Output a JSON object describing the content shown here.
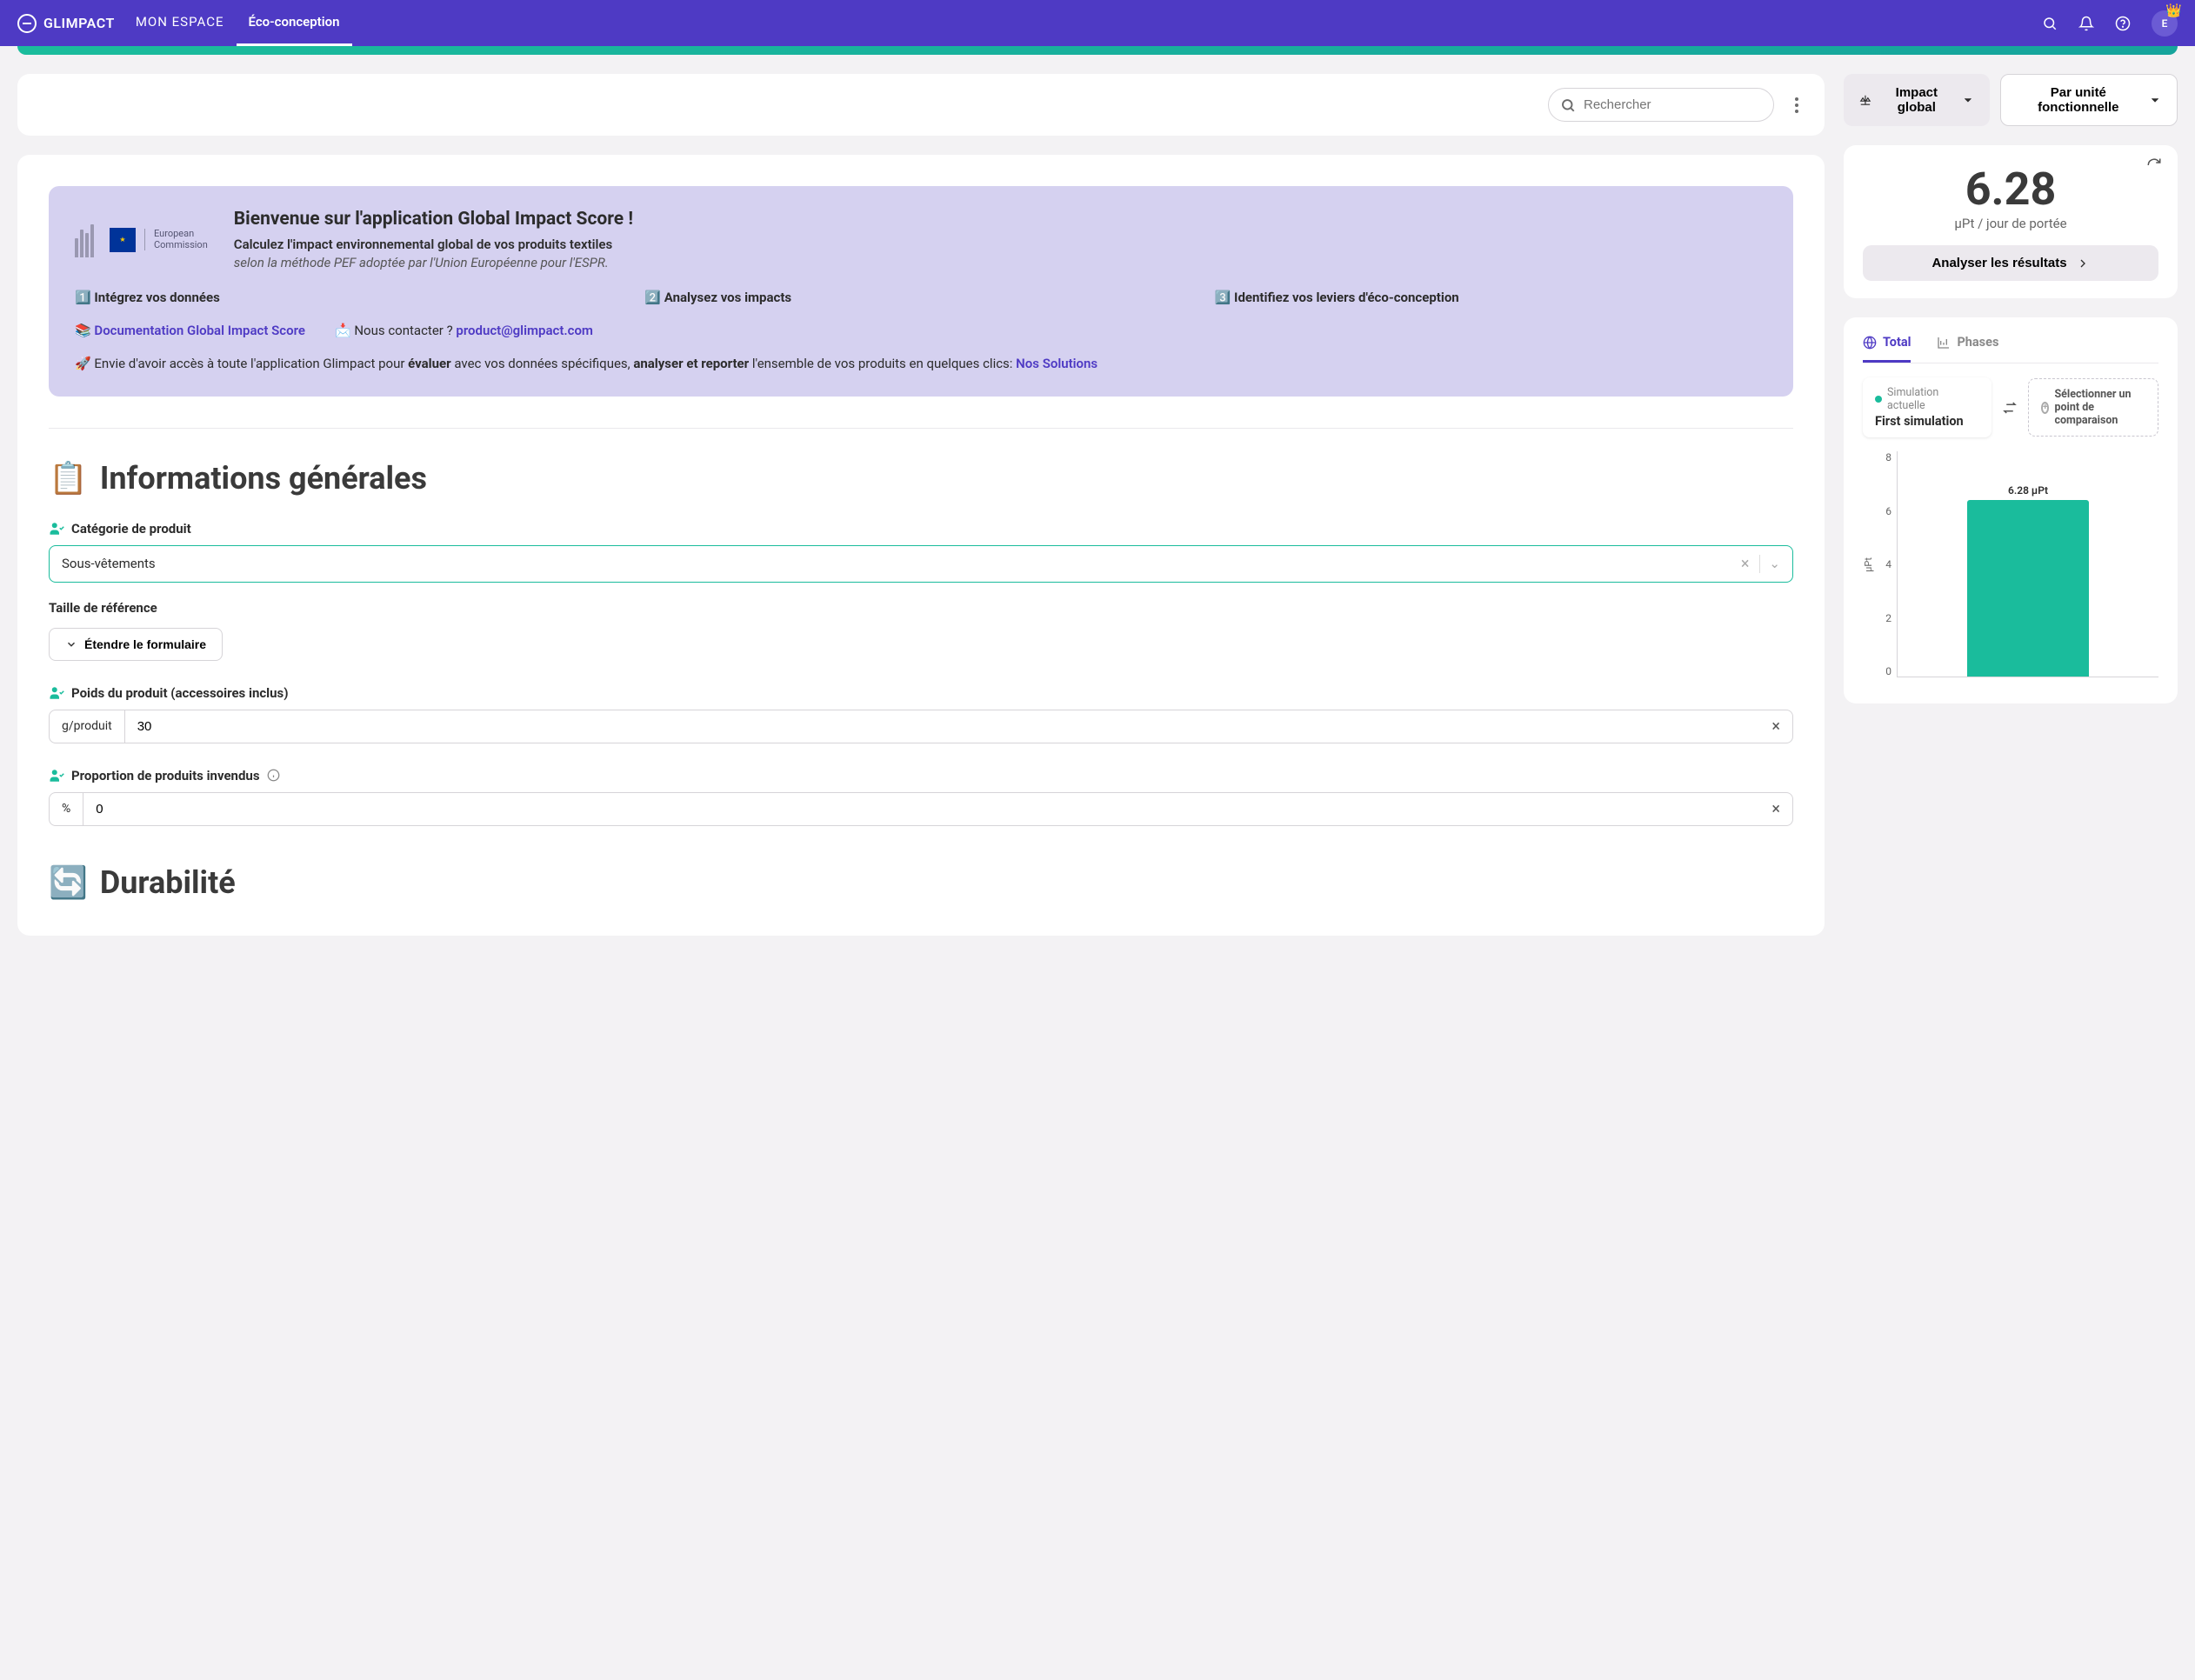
{
  "nav": {
    "logo": "GLIMPACT",
    "mon_espace": "MON ESPACE",
    "tab_active": "Éco-conception",
    "avatar_initial": "E"
  },
  "search": {
    "placeholder": "Rechercher"
  },
  "welcome": {
    "title": "Bienvenue sur l'application Global Impact Score !",
    "line1": "Calculez l'impact environnemental global de vos produits textiles",
    "line2": "selon la méthode PEF adoptée par l'Union Européenne pour l'ESPR.",
    "eu_lbl_1": "European",
    "eu_lbl_2": "Commission",
    "step1": "1️⃣ Intégrez vos données",
    "step2": "2️⃣ Analysez vos impacts",
    "step3": "3️⃣ Identifiez vos leviers d'éco-conception",
    "doc_label": "Documentation Global Impact Score",
    "doc_emoji": "📚",
    "contact_prefix": "📩 Nous contacter ? ",
    "contact_email": "product@glimpact.com",
    "promo_pre": "🚀 Envie d'avoir accès à toute l'application Glimpact pour ",
    "promo_b1": "évaluer",
    "promo_mid": " avec vos données spécifiques, ",
    "promo_b2": "analyser et reporter",
    "promo_end": " l'ensemble de vos produits en quelques clics: ",
    "promo_link": "Nos Solutions"
  },
  "section1": {
    "emoji": "📋",
    "title": "Informations générales"
  },
  "fields": {
    "cat_label": "Catégorie de produit",
    "cat_value": "Sous-vêtements",
    "taille_label": "Taille de référence",
    "expand_btn": "Étendre le formulaire",
    "poids_label": "Poids du produit (accessoires inclus)",
    "poids_unit": "g/produit",
    "poids_value": "30",
    "unsold_label": "Proportion de produits invendus",
    "unsold_unit": "%",
    "unsold_value": "0"
  },
  "section2": {
    "emoji": "🔄",
    "title": "Durabilité"
  },
  "right": {
    "btn_impact": "Impact global",
    "btn_unit": "Par unité fonctionnelle",
    "score": "6.28",
    "score_unit": "µPt / jour de portée",
    "analyze_btn": "Analyser les résultats",
    "tab_total": "Total",
    "tab_phases": "Phases",
    "sim_lbl": "Simulation actuelle",
    "sim_name": "First simulation",
    "compare_lbl": "Sélectionner un point de comparaison",
    "y_axis": "µPt"
  },
  "chart_data": {
    "type": "bar",
    "categories": [
      ""
    ],
    "values": [
      6.28
    ],
    "data_labels": [
      "6.28 µPt"
    ],
    "ylim": [
      0,
      8
    ],
    "yticks": [
      0,
      2,
      4,
      6,
      8
    ],
    "ylabel": "µPt",
    "bar_color": "#1abc9c"
  }
}
